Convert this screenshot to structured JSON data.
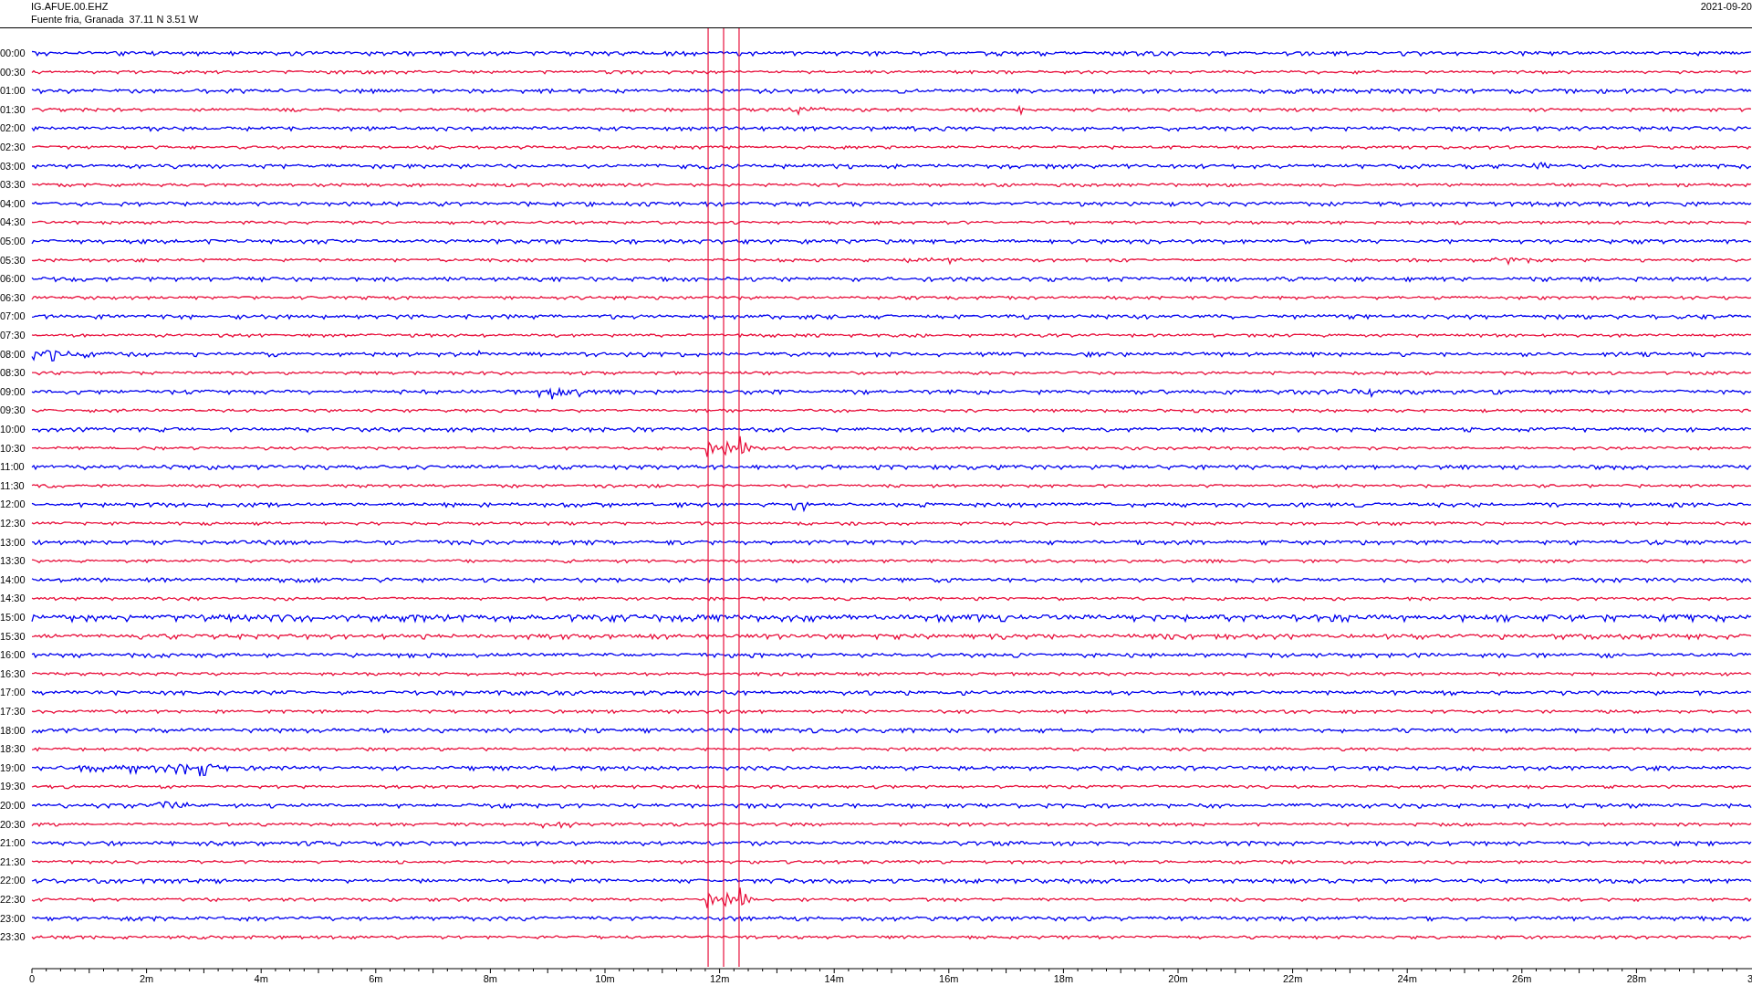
{
  "header": {
    "station": "IG.AFUE.00.EHZ",
    "location": "Fuente fria, Granada  37.11 N 3.51 W",
    "date": "2021-09-20"
  },
  "traces": [
    {
      "label": "00:00",
      "color": "#0000ee"
    },
    {
      "label": "00:30",
      "color": "#e8103c"
    },
    {
      "label": "01:00",
      "color": "#0000ee"
    },
    {
      "label": "01:30",
      "color": "#e8103c"
    },
    {
      "label": "02:00",
      "color": "#0000ee"
    },
    {
      "label": "02:30",
      "color": "#e8103c"
    },
    {
      "label": "03:00",
      "color": "#0000ee"
    },
    {
      "label": "03:30",
      "color": "#e8103c"
    },
    {
      "label": "04:00",
      "color": "#0000ee"
    },
    {
      "label": "04:30",
      "color": "#e8103c"
    },
    {
      "label": "05:00",
      "color": "#0000ee"
    },
    {
      "label": "05:30",
      "color": "#e8103c"
    },
    {
      "label": "06:00",
      "color": "#0000ee"
    },
    {
      "label": "06:30",
      "color": "#e8103c"
    },
    {
      "label": "07:00",
      "color": "#0000ee"
    },
    {
      "label": "07:30",
      "color": "#e8103c"
    },
    {
      "label": "08:00",
      "color": "#0000ee"
    },
    {
      "label": "08:30",
      "color": "#e8103c"
    },
    {
      "label": "09:00",
      "color": "#0000ee"
    },
    {
      "label": "09:30",
      "color": "#e8103c"
    },
    {
      "label": "10:00",
      "color": "#0000ee"
    },
    {
      "label": "10:30",
      "color": "#e8103c"
    },
    {
      "label": "11:00",
      "color": "#0000ee"
    },
    {
      "label": "11:30",
      "color": "#e8103c"
    },
    {
      "label": "12:00",
      "color": "#0000ee"
    },
    {
      "label": "12:30",
      "color": "#e8103c"
    },
    {
      "label": "13:00",
      "color": "#0000ee"
    },
    {
      "label": "13:30",
      "color": "#e8103c"
    },
    {
      "label": "14:00",
      "color": "#0000ee"
    },
    {
      "label": "14:30",
      "color": "#e8103c"
    },
    {
      "label": "15:00",
      "color": "#0000ee"
    },
    {
      "label": "15:30",
      "color": "#e8103c"
    },
    {
      "label": "16:00",
      "color": "#0000ee"
    },
    {
      "label": "16:30",
      "color": "#e8103c"
    },
    {
      "label": "17:00",
      "color": "#0000ee"
    },
    {
      "label": "17:30",
      "color": "#e8103c"
    },
    {
      "label": "18:00",
      "color": "#0000ee"
    },
    {
      "label": "18:30",
      "color": "#e8103c"
    },
    {
      "label": "19:00",
      "color": "#0000ee"
    },
    {
      "label": "19:30",
      "color": "#e8103c"
    },
    {
      "label": "20:00",
      "color": "#0000ee"
    },
    {
      "label": "20:30",
      "color": "#e8103c"
    },
    {
      "label": "21:00",
      "color": "#0000ee"
    },
    {
      "label": "21:30",
      "color": "#e8103c"
    },
    {
      "label": "22:00",
      "color": "#0000ee"
    },
    {
      "label": "22:30",
      "color": "#e8103c"
    },
    {
      "label": "23:00",
      "color": "#0000ee"
    },
    {
      "label": "23:30",
      "color": "#e8103c"
    }
  ],
  "x_axis": {
    "ticks": [
      "0",
      "2m",
      "4m",
      "6m",
      "8m",
      "10m",
      "12m",
      "14m",
      "16m",
      "18m",
      "20m",
      "22m",
      "24m",
      "26m",
      "28m",
      "3"
    ]
  }
}
